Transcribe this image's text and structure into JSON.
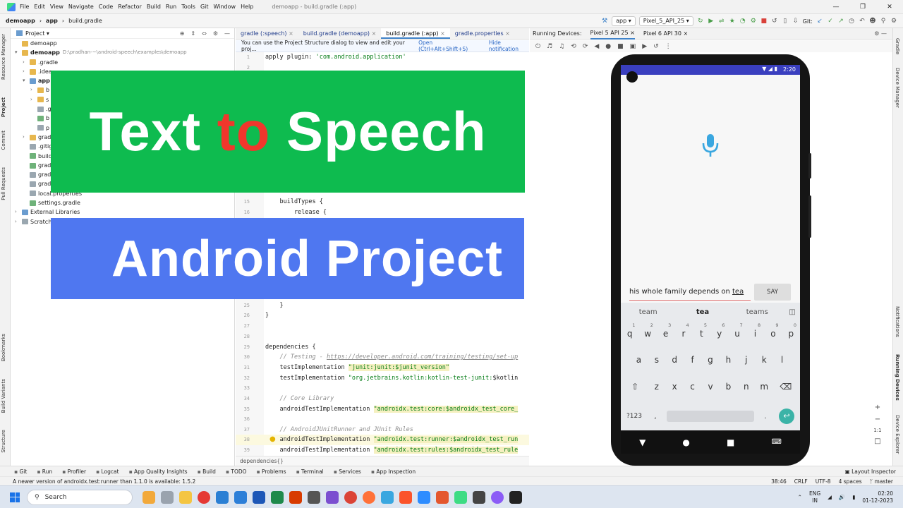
{
  "menu": {
    "items": [
      "File",
      "Edit",
      "View",
      "Navigate",
      "Code",
      "Refactor",
      "Build",
      "Run",
      "Tools",
      "Git",
      "Window",
      "Help"
    ],
    "window_title": "demoapp - build.gradle (:app)"
  },
  "breadcrumb": {
    "project": "demoapp",
    "module": "app",
    "file": "build.gradle"
  },
  "toolbar": {
    "run_config": "app",
    "device": "Pixel_5_API_25",
    "git_label": "Git:"
  },
  "project_panel": {
    "title": "Project",
    "items": [
      {
        "label": "demoapp",
        "indent": 0,
        "arrow": "",
        "icon": "folder"
      },
      {
        "label": "demoapp",
        "path": "D:\\pradhan-~\\android-speech\\examples\\demoapp",
        "indent": 0,
        "arrow": "v",
        "icon": "folder",
        "bold": true
      },
      {
        "label": ".gradle",
        "indent": 1,
        "arrow": ">",
        "icon": "folder"
      },
      {
        "label": ".idea",
        "indent": 1,
        "arrow": ">",
        "icon": "folder"
      },
      {
        "label": "app",
        "indent": 1,
        "arrow": "v",
        "icon": "module",
        "bold": true
      },
      {
        "label": "b",
        "indent": 2,
        "arrow": ">",
        "icon": "folder"
      },
      {
        "label": "s",
        "indent": 2,
        "arrow": ">",
        "icon": "folder"
      },
      {
        "label": ".g",
        "indent": 2,
        "arrow": "",
        "icon": "file"
      },
      {
        "label": "b",
        "indent": 2,
        "arrow": "",
        "icon": "gradlef"
      },
      {
        "label": "p",
        "indent": 2,
        "arrow": "",
        "icon": "file"
      },
      {
        "label": "grad",
        "indent": 1,
        "arrow": ">",
        "icon": "folder"
      },
      {
        "label": ".gitig",
        "indent": 1,
        "arrow": "",
        "icon": "file"
      },
      {
        "label": "build",
        "indent": 1,
        "arrow": "",
        "icon": "gradlef"
      },
      {
        "label": "grad",
        "indent": 1,
        "arrow": "",
        "icon": "gradlef"
      },
      {
        "label": "grad",
        "indent": 1,
        "arrow": "",
        "icon": "file"
      },
      {
        "label": "grad",
        "indent": 1,
        "arrow": "",
        "icon": "file"
      },
      {
        "label": "local.properties",
        "indent": 1,
        "arrow": "",
        "icon": "file"
      },
      {
        "label": "settings.gradle",
        "indent": 1,
        "arrow": "",
        "icon": "gradlef"
      },
      {
        "label": "External Libraries",
        "indent": 0,
        "arrow": ">",
        "icon": "module"
      },
      {
        "label": "Scratche",
        "indent": 0,
        "arrow": ">",
        "icon": "file"
      }
    ]
  },
  "editor": {
    "tabs": [
      {
        "label": "gradle (:speech)",
        "active": false
      },
      {
        "label": "build.gradle (demoapp)",
        "active": false
      },
      {
        "label": "build.gradle (:app)",
        "active": true
      },
      {
        "label": "gradle.properties",
        "active": false
      }
    ],
    "notice": {
      "text": "You can use the Project Structure dialog to view and edit your proj...",
      "open_link": "Open (Ctrl+Alt+Shift+S)",
      "hide_link": "Hide notification"
    },
    "lines": [
      {
        "n": "1",
        "parts": [
          [
            "",
            "apply plugin: "
          ],
          [
            "str",
            "'com.android.application'"
          ]
        ]
      },
      {
        "n": "2",
        "parts": []
      },
      {
        "n": "14",
        "parts": []
      },
      {
        "n": "15",
        "parts": [
          [
            "",
            "    buildTypes {"
          ]
        ]
      },
      {
        "n": "16",
        "parts": [
          [
            "",
            "        release {"
          ]
        ]
      },
      {
        "n": "25",
        "parts": [
          [
            "",
            "    }"
          ]
        ]
      },
      {
        "n": "26",
        "parts": [
          [
            "",
            "}"
          ]
        ]
      },
      {
        "n": "27",
        "parts": []
      },
      {
        "n": "28",
        "parts": []
      },
      {
        "n": "29",
        "parts": [
          [
            "",
            "dependencies {"
          ]
        ]
      },
      {
        "n": "30",
        "parts": [
          [
            "cm",
            "    // Testing - "
          ],
          [
            "lk",
            "https://developer.android.com/training/testing/set-up"
          ]
        ]
      },
      {
        "n": "31",
        "parts": [
          [
            "",
            "    testImplementation "
          ],
          [
            "strhl",
            "\"junit:junit:$junit_version\""
          ]
        ]
      },
      {
        "n": "32",
        "parts": [
          [
            "",
            "    testImplementation "
          ],
          [
            "str",
            "\"org.jetbrains.kotlin:kotlin-test-junit:"
          ],
          [
            "",
            "$kotlin"
          ]
        ]
      },
      {
        "n": "33",
        "parts": []
      },
      {
        "n": "34",
        "parts": [
          [
            "cm",
            "    // Core Library"
          ]
        ]
      },
      {
        "n": "35",
        "parts": [
          [
            "",
            "    androidTestImplementation "
          ],
          [
            "strhl",
            "\"androidx.test:core:$androidx_test_core_"
          ]
        ]
      },
      {
        "n": "36",
        "parts": []
      },
      {
        "n": "37",
        "parts": [
          [
            "cm",
            "    // AndroidJUnitRunner and JUnit Rules"
          ]
        ]
      },
      {
        "n": "38",
        "parts": [
          [
            "",
            "    androidTestImplementation "
          ],
          [
            "strhl",
            "\"androidx.test:runner:$androidx_test_run"
          ]
        ],
        "hl": true
      },
      {
        "n": "39",
        "parts": [
          [
            "",
            "    androidTestImplementation "
          ],
          [
            "strhl",
            "\"androidx.test:rules:$androidx_test_rule"
          ]
        ]
      }
    ],
    "status": "dependencies{}"
  },
  "running_devices": {
    "label": "Running Devices:",
    "tabs": [
      "Pixel 5 API 25",
      "Pixel 6 API 30"
    ]
  },
  "phone": {
    "time": "2:20",
    "input_text": "his whole family depends on ",
    "input_underlined": "tea",
    "say_button": "SAY",
    "suggestions": [
      "team",
      "tea",
      "teams"
    ],
    "row1": [
      "q",
      "w",
      "e",
      "r",
      "t",
      "y",
      "u",
      "i",
      "o",
      "p"
    ],
    "row1_nums": [
      "1",
      "2",
      "3",
      "4",
      "5",
      "6",
      "7",
      "8",
      "9",
      "0"
    ],
    "row2": [
      "a",
      "s",
      "d",
      "f",
      "g",
      "h",
      "j",
      "k",
      "l"
    ],
    "row3": [
      "z",
      "x",
      "c",
      "v",
      "b",
      "n",
      "m"
    ],
    "sym_key": "?123",
    "comma": ",",
    "period": "."
  },
  "banners": {
    "line1_a": "Text ",
    "line1_b": "to",
    "line1_c": " Speech",
    "line2": "Android Project",
    "colors": {
      "green": "#0ebb4f",
      "blue": "#4f77f0",
      "red": "#f0372c"
    }
  },
  "left_strip": [
    "Resource Manager",
    "Project",
    "Commit",
    "Pull Requests",
    "Bookmarks",
    "Build Variants",
    "Structure"
  ],
  "right_strip": [
    "Gradle",
    "Device Manager",
    "Notifications",
    "Running Devices",
    "Device Explorer"
  ],
  "tool_windows": [
    "Git",
    "Run",
    "Profiler",
    "Logcat",
    "App Quality Insights",
    "Build",
    "TODO",
    "Problems",
    "Terminal",
    "Services",
    "App Inspection"
  ],
  "layout_inspector": "Layout Inspector",
  "status_message": "A newer version of androidx.test:runner than 1.1.0 is available: 1.5.2",
  "status_right": [
    "38:46",
    "CRLF",
    "UTF-8",
    "4 spaces",
    "master"
  ],
  "taskbar": {
    "search": "Search",
    "lang1": "ENG",
    "lang2": "IN",
    "time": "02:20",
    "date": "01-12-2023"
  }
}
